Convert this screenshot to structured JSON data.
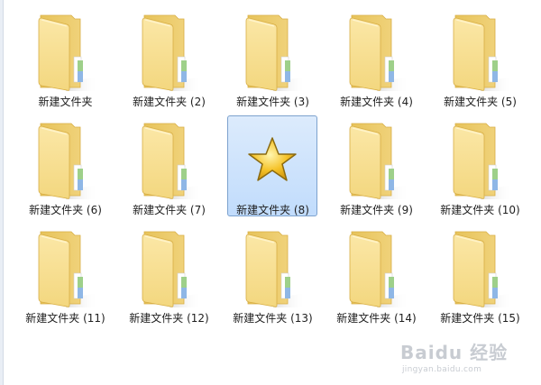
{
  "colors": {
    "folder_front": "#f3d77f",
    "folder_back": "#e7c35a",
    "folder_edge": "#d8ae45",
    "selection_bg": "#cfe3fc",
    "selection_border": "#7da2ce",
    "star_fill": "#f5c32a"
  },
  "items": [
    {
      "label": "新建文件夹",
      "icon": "folder-icon",
      "selected": false
    },
    {
      "label": "新建文件夹 (2)",
      "icon": "folder-icon",
      "selected": false
    },
    {
      "label": "新建文件夹 (3)",
      "icon": "folder-icon",
      "selected": false
    },
    {
      "label": "新建文件夹 (4)",
      "icon": "folder-icon",
      "selected": false
    },
    {
      "label": "新建文件夹 (5)",
      "icon": "folder-icon",
      "selected": false
    },
    {
      "label": "新建文件夹 (6)",
      "icon": "folder-icon",
      "selected": false
    },
    {
      "label": "新建文件夹 (7)",
      "icon": "folder-icon",
      "selected": false
    },
    {
      "label": "新建文件夹 (8)",
      "icon": "star-icon",
      "selected": true
    },
    {
      "label": "新建文件夹 (9)",
      "icon": "folder-icon",
      "selected": false
    },
    {
      "label": "新建文件夹 (10)",
      "icon": "folder-icon",
      "selected": false
    },
    {
      "label": "新建文件夹 (11)",
      "icon": "folder-icon",
      "selected": false
    },
    {
      "label": "新建文件夹 (12)",
      "icon": "folder-icon",
      "selected": false
    },
    {
      "label": "新建文件夹 (13)",
      "icon": "folder-icon",
      "selected": false
    },
    {
      "label": "新建文件夹 (14)",
      "icon": "folder-icon",
      "selected": false
    },
    {
      "label": "新建文件夹 (15)",
      "icon": "folder-icon",
      "selected": false
    }
  ],
  "watermark": {
    "logo": "Baidu 经验",
    "url": "jingyan.baidu.com"
  }
}
